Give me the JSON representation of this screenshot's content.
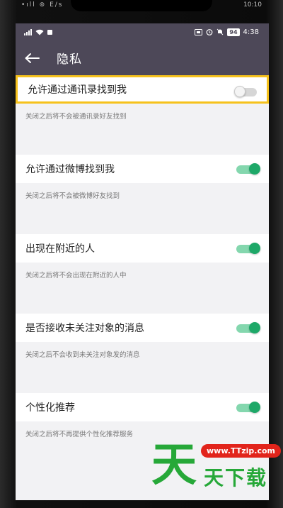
{
  "outer_status": {
    "left": "•ıll ⊚ E/s",
    "time": "10:10"
  },
  "status_bar": {
    "battery": "94",
    "time": "4:38"
  },
  "header": {
    "title": "隐私",
    "back_icon": "back-arrow-icon"
  },
  "settings": [
    {
      "label": "允许通过通讯录找到我",
      "description": "关闭之后将不会被通讯录好友找到",
      "enabled": false,
      "highlighted": true
    },
    {
      "label": "允许通过微博找到我",
      "description": "关闭之后将不会被微博好友找到",
      "enabled": true,
      "highlighted": false
    },
    {
      "label": "出现在附近的人",
      "description": "关闭之后将不会出现在附近的人中",
      "enabled": true,
      "highlighted": false
    },
    {
      "label": "是否接收未关注对象的消息",
      "description": "关闭之后不会收到未关注对象发的消息",
      "enabled": true,
      "highlighted": false
    },
    {
      "label": "个性化推荐",
      "description": "关闭之后将不再提供个性化推荐服务",
      "enabled": true,
      "highlighted": false
    }
  ],
  "watermark": {
    "url": "www.TTzip.com",
    "logo_char": "天",
    "text": "天下载"
  },
  "colors": {
    "header": "#4d4858",
    "toggle_on": "#1ea868",
    "highlight": "#f6c21c",
    "watermark_green": "#26a838",
    "watermark_red": "#e2241b"
  }
}
